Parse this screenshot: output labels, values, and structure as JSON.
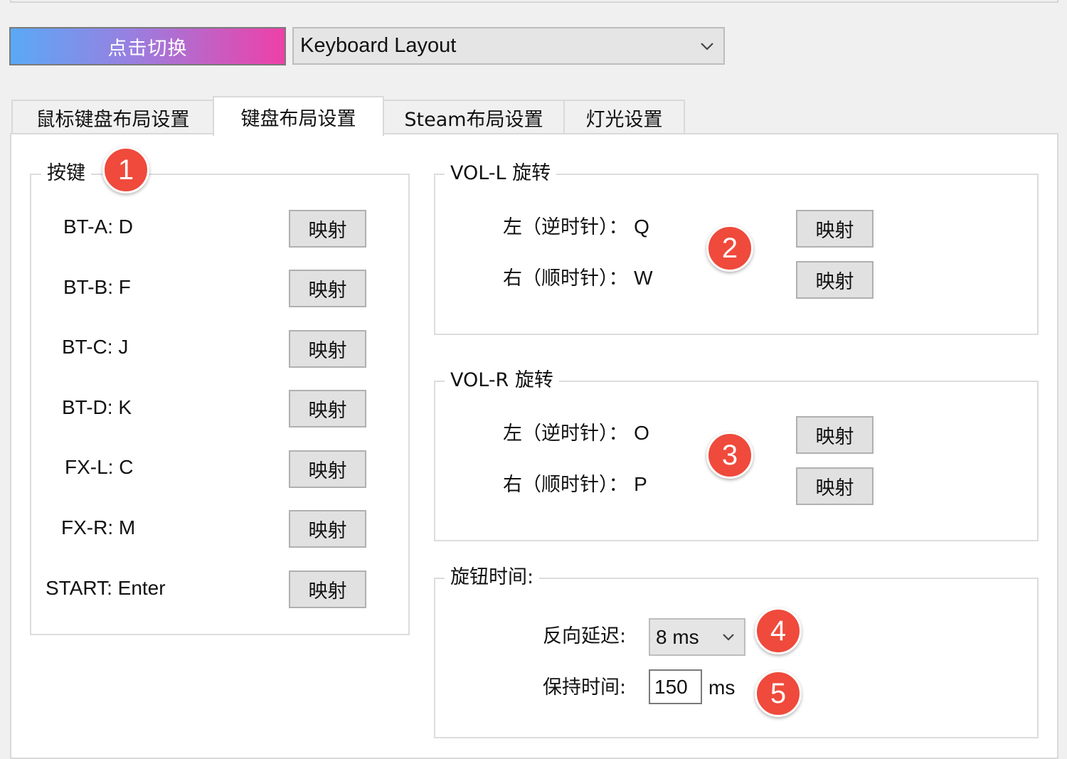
{
  "toolbar": {
    "switch_label": "点击切换",
    "layout_select": {
      "value": "Keyboard Layout",
      "icon": "chevron-down-icon"
    }
  },
  "tabs": [
    {
      "label": "鼠标键盘布局设置",
      "active": false
    },
    {
      "label": "键盘布局设置",
      "active": true
    },
    {
      "label": "Steam布局设置",
      "active": false
    },
    {
      "label": "灯光设置",
      "active": false
    }
  ],
  "keys_group": {
    "title": "按键",
    "badge": "1",
    "rows": [
      {
        "label": "BT-A: D",
        "button": "映射"
      },
      {
        "label": "BT-B: F",
        "button": "映射"
      },
      {
        "label": "BT-C: J",
        "button": "映射"
      },
      {
        "label": "BT-D: K",
        "button": "映射"
      },
      {
        "label": "FX-L: C",
        "button": "映射"
      },
      {
        "label": "FX-R: M",
        "button": "映射"
      },
      {
        "label": "START: Enter",
        "button": "映射"
      }
    ]
  },
  "vol_l": {
    "title": "VOL-L 旋转",
    "badge": "2",
    "left": {
      "label": "左（逆时针）：",
      "key": "Q",
      "button": "映射"
    },
    "right": {
      "label": "右（顺时针）：",
      "key": "W",
      "button": "映射"
    }
  },
  "vol_r": {
    "title": "VOL-R 旋转",
    "badge": "3",
    "left": {
      "label": "左（逆时针）：",
      "key": "O",
      "button": "映射"
    },
    "right": {
      "label": "右（顺时针）：",
      "key": "P",
      "button": "映射"
    }
  },
  "knob_time": {
    "title": "旋钮时间:",
    "reverse_delay": {
      "label": "反向延迟:",
      "value": "8 ms",
      "badge": "4"
    },
    "hold_time": {
      "label": "保持时间:",
      "value": "150",
      "unit": "ms",
      "badge": "5"
    }
  },
  "colors": {
    "badge": "#ef4a3c",
    "switch_gradient_start": "#5aa9f6",
    "switch_gradient_end": "#ee40a8"
  }
}
